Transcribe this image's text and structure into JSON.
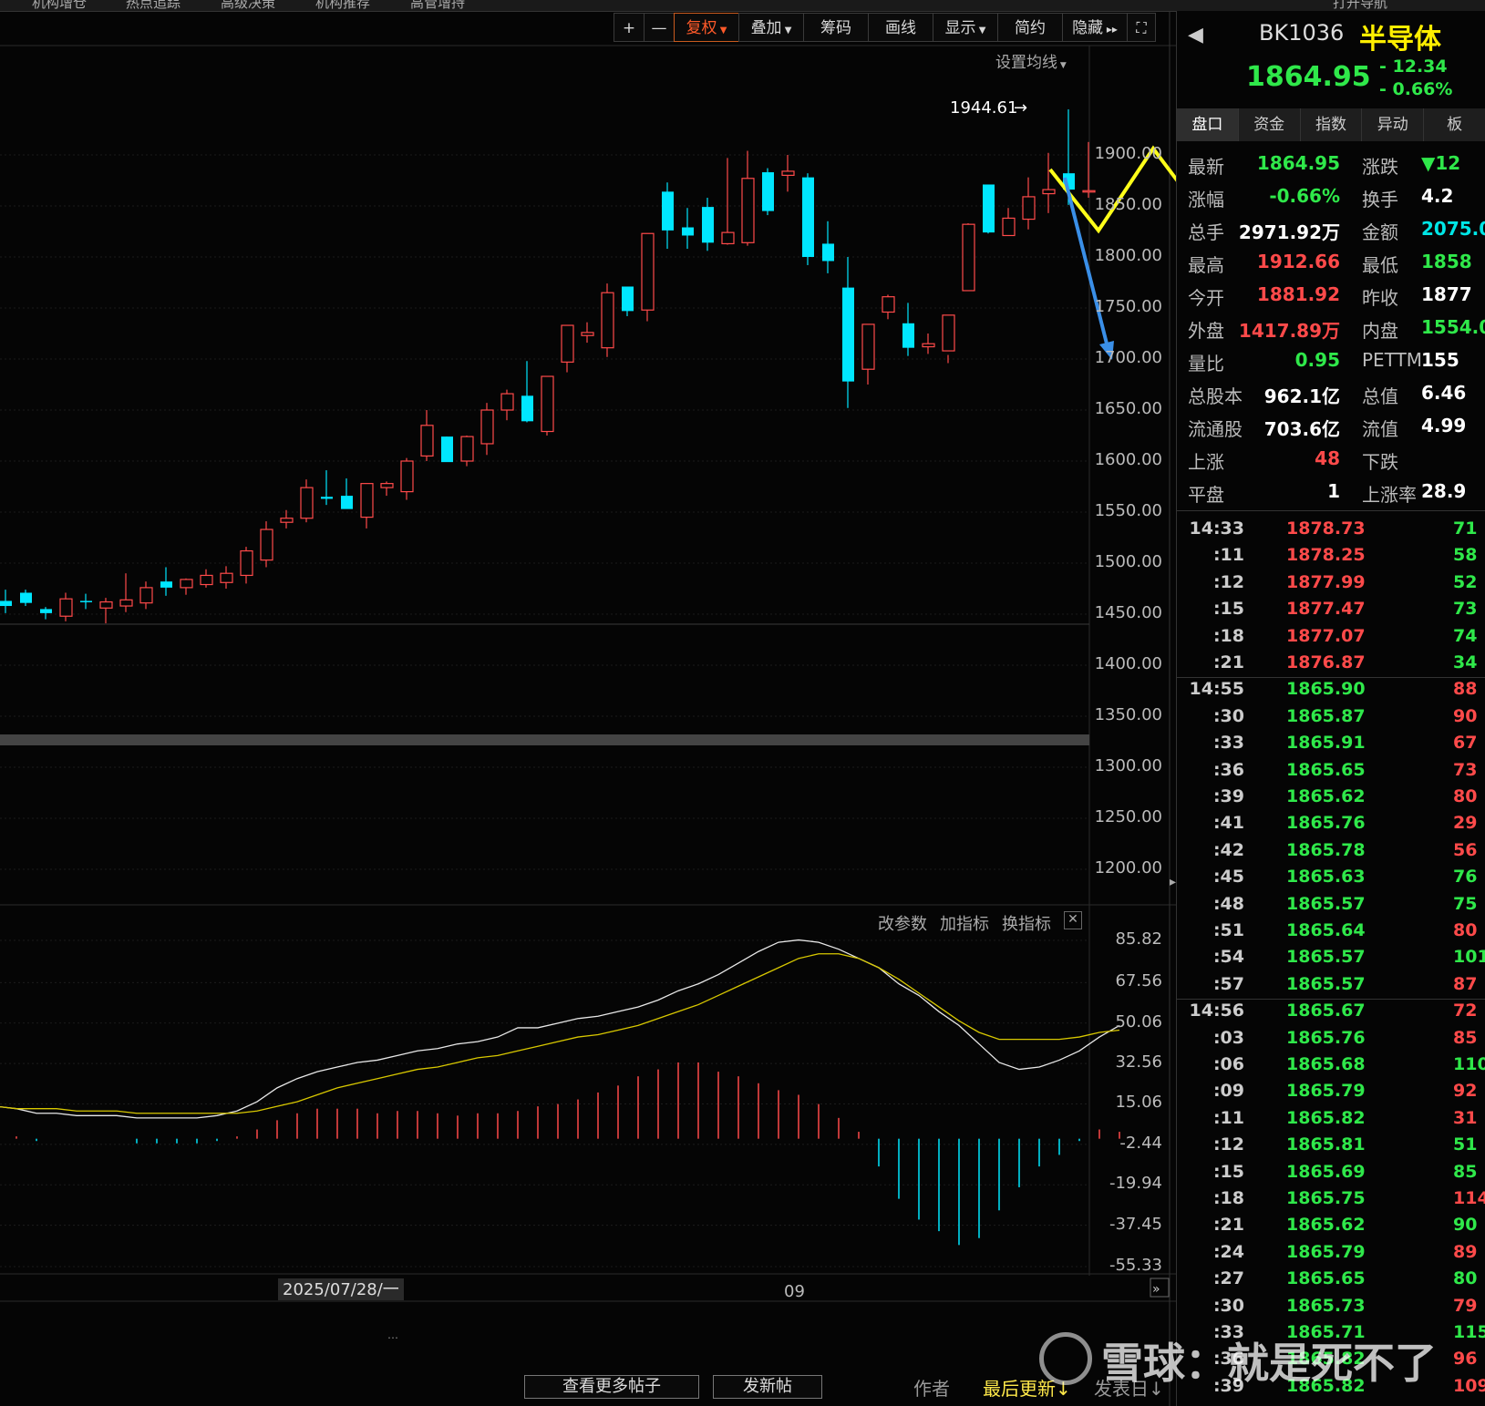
{
  "topbar": {
    "items": [
      "机构增仓",
      "热点追踪",
      "高级决策",
      "机构推荐",
      "高管增持",
      "打开导航"
    ]
  },
  "toolbar": {
    "buttons": [
      "+",
      "—",
      "复权",
      "叠加",
      "筹码",
      "画线",
      "显示",
      "简约",
      "隐藏"
    ]
  },
  "chart_header": {
    "ma_settings": "设置均线"
  },
  "price_axis": [
    "1900.00",
    "1850.00",
    "1800.00",
    "1750.00",
    "1700.00",
    "1650.00",
    "1600.00",
    "1550.00",
    "1500.00",
    "1450.00",
    "1400.00",
    "1350.00",
    "1300.00",
    "1250.00",
    "1200.00"
  ],
  "high_marker": "1944.61",
  "indicator": {
    "controls": [
      "改参数",
      "加指标",
      "换指标"
    ],
    "axis": [
      "85.82",
      "67.56",
      "50.06",
      "32.56",
      "15.06",
      "-2.44",
      "-19.94",
      "-37.45",
      "-55.33"
    ]
  },
  "x_axis": {
    "date_label": "2025/07/28/一",
    "month_label": "09"
  },
  "stock": {
    "code": "BK1036",
    "name": "半导体",
    "price": "1864.95",
    "change": "- 12.34",
    "pct": "- 0.66%"
  },
  "panel_tabs": [
    "盘口",
    "资金",
    "指数",
    "异动",
    "板"
  ],
  "quote": [
    {
      "l1": "最新",
      "v1": "1864.95",
      "c1": "green",
      "l2": "涨跌",
      "v2": "▼12",
      "c2": "green"
    },
    {
      "l1": "涨幅",
      "v1": "-0.66%",
      "c1": "green",
      "l2": "换手",
      "v2": "4.2",
      "c2": "white"
    },
    {
      "l1": "总手",
      "v1": "2971.92万",
      "c1": "white",
      "l2": "金额",
      "v2": "2075.0",
      "c2": "cyan"
    },
    {
      "l1": "最高",
      "v1": "1912.66",
      "c1": "red",
      "l2": "最低",
      "v2": "1858",
      "c2": "green"
    },
    {
      "l1": "今开",
      "v1": "1881.92",
      "c1": "red",
      "l2": "昨收",
      "v2": "1877",
      "c2": "white"
    },
    {
      "l1": "外盘",
      "v1": "1417.89万",
      "c1": "red",
      "l2": "内盘",
      "v2": "1554.0",
      "c2": "green"
    },
    {
      "l1": "量比",
      "v1": "0.95",
      "c1": "green",
      "l2": "PETTM",
      "v2": "155",
      "c2": "white"
    },
    {
      "l1": "总股本",
      "v1": "962.1亿",
      "c1": "white",
      "l2": "总值",
      "v2": "6.46",
      "c2": "white"
    },
    {
      "l1": "流通股",
      "v1": "703.6亿",
      "c1": "white",
      "l2": "流值",
      "v2": "4.99",
      "c2": "white"
    },
    {
      "l1": "上涨",
      "v1": "48",
      "c1": "red",
      "l2": "下跌",
      "v2": "",
      "c2": "green"
    },
    {
      "l1": "平盘",
      "v1": "1",
      "c1": "white",
      "l2": "上涨率",
      "v2": "28.9",
      "c2": "white"
    }
  ],
  "ticks": [
    {
      "t": "14:33",
      "p": "1878.73",
      "pc": "red",
      "v": "71",
      "vc": "green",
      "bold": true
    },
    {
      "t": ":11",
      "p": "1878.25",
      "pc": "red",
      "v": "58",
      "vc": "green"
    },
    {
      "t": ":12",
      "p": "1877.99",
      "pc": "red",
      "v": "52",
      "vc": "green"
    },
    {
      "t": ":15",
      "p": "1877.47",
      "pc": "red",
      "v": "73",
      "vc": "green"
    },
    {
      "t": ":18",
      "p": "1877.07",
      "pc": "red",
      "v": "74",
      "vc": "green"
    },
    {
      "t": ":21",
      "p": "1876.87",
      "pc": "red",
      "v": "34",
      "vc": "green"
    },
    {
      "t": "14:55",
      "p": "1865.90",
      "pc": "green",
      "v": "88",
      "vc": "red",
      "bold": true
    },
    {
      "t": ":30",
      "p": "1865.87",
      "pc": "green",
      "v": "90",
      "vc": "red"
    },
    {
      "t": ":33",
      "p": "1865.91",
      "pc": "green",
      "v": "67",
      "vc": "red"
    },
    {
      "t": ":36",
      "p": "1865.65",
      "pc": "green",
      "v": "73",
      "vc": "red"
    },
    {
      "t": ":39",
      "p": "1865.62",
      "pc": "green",
      "v": "80",
      "vc": "red"
    },
    {
      "t": ":41",
      "p": "1865.76",
      "pc": "green",
      "v": "29",
      "vc": "red"
    },
    {
      "t": ":42",
      "p": "1865.78",
      "pc": "green",
      "v": "56",
      "vc": "red"
    },
    {
      "t": ":45",
      "p": "1865.63",
      "pc": "green",
      "v": "76",
      "vc": "green"
    },
    {
      "t": ":48",
      "p": "1865.57",
      "pc": "green",
      "v": "75",
      "vc": "green"
    },
    {
      "t": ":51",
      "p": "1865.64",
      "pc": "green",
      "v": "80",
      "vc": "red"
    },
    {
      "t": ":54",
      "p": "1865.57",
      "pc": "green",
      "v": "101",
      "vc": "green"
    },
    {
      "t": ":57",
      "p": "1865.57",
      "pc": "green",
      "v": "87",
      "vc": "red"
    },
    {
      "t": "14:56",
      "p": "1865.67",
      "pc": "green",
      "v": "72",
      "vc": "red",
      "bold": true
    },
    {
      "t": ":03",
      "p": "1865.76",
      "pc": "green",
      "v": "85",
      "vc": "red"
    },
    {
      "t": ":06",
      "p": "1865.68",
      "pc": "green",
      "v": "110",
      "vc": "green"
    },
    {
      "t": ":09",
      "p": "1865.79",
      "pc": "green",
      "v": "92",
      "vc": "red"
    },
    {
      "t": ":11",
      "p": "1865.82",
      "pc": "green",
      "v": "31",
      "vc": "red"
    },
    {
      "t": ":12",
      "p": "1865.81",
      "pc": "green",
      "v": "51",
      "vc": "green"
    },
    {
      "t": ":15",
      "p": "1865.69",
      "pc": "green",
      "v": "85",
      "vc": "green"
    },
    {
      "t": ":18",
      "p": "1865.75",
      "pc": "green",
      "v": "114",
      "vc": "red"
    },
    {
      "t": ":21",
      "p": "1865.62",
      "pc": "green",
      "v": "90",
      "vc": "green"
    },
    {
      "t": ":24",
      "p": "1865.79",
      "pc": "green",
      "v": "89",
      "vc": "red"
    },
    {
      "t": ":27",
      "p": "1865.65",
      "pc": "green",
      "v": "80",
      "vc": "green"
    },
    {
      "t": ":30",
      "p": "1865.73",
      "pc": "green",
      "v": "79",
      "vc": "red"
    },
    {
      "t": ":33",
      "p": "1865.71",
      "pc": "green",
      "v": "115",
      "vc": "green"
    },
    {
      "t": ":36",
      "p": "1865.82",
      "pc": "green",
      "v": "96",
      "vc": "red"
    },
    {
      "t": ":39",
      "p": "1865.82",
      "pc": "green",
      "v": "109",
      "vc": "red"
    }
  ],
  "bottom": {
    "more_posts": "查看更多帖子",
    "new_post": "发新帖",
    "author": "作者",
    "last_update": "最后更新↓",
    "post_date": "发表日↓"
  },
  "watermark": "雪球：就是死不了",
  "candles": [
    [
      1463,
      1474,
      1451,
      1458
    ],
    [
      1471,
      1474,
      1458,
      1461
    ],
    [
      1455,
      1457,
      1445,
      1451
    ],
    [
      1448,
      1471,
      1443,
      1465
    ],
    [
      1463,
      1470,
      1455,
      1462
    ],
    [
      1456,
      1466,
      1441,
      1462
    ],
    [
      1458,
      1490,
      1452,
      1464
    ],
    [
      1461,
      1482,
      1455,
      1476
    ],
    [
      1482,
      1496,
      1468,
      1476
    ],
    [
      1476,
      1485,
      1469,
      1484
    ],
    [
      1479,
      1494,
      1476,
      1488
    ],
    [
      1481,
      1497,
      1475,
      1490
    ],
    [
      1488,
      1516,
      1480,
      1512
    ],
    [
      1503,
      1541,
      1496,
      1533
    ],
    [
      1540,
      1552,
      1534,
      1544
    ],
    [
      1544,
      1582,
      1540,
      1574
    ],
    [
      1565,
      1591,
      1557,
      1563
    ],
    [
      1566,
      1583,
      1554,
      1553
    ],
    [
      1545,
      1570,
      1534,
      1578
    ],
    [
      1574,
      1580,
      1566,
      1578
    ],
    [
      1570,
      1603,
      1562,
      1600
    ],
    [
      1605,
      1650,
      1600,
      1635
    ],
    [
      1624,
      1624,
      1604,
      1599
    ],
    [
      1600,
      1625,
      1595,
      1624
    ],
    [
      1617,
      1657,
      1606,
      1650
    ],
    [
      1650,
      1670,
      1640,
      1666
    ],
    [
      1664,
      1698,
      1638,
      1639
    ],
    [
      1629,
      1668,
      1625,
      1683
    ],
    [
      1697,
      1722,
      1687,
      1733
    ],
    [
      1723,
      1736,
      1716,
      1726
    ],
    [
      1711,
      1774,
      1702,
      1765
    ],
    [
      1771,
      1767,
      1742,
      1747
    ],
    [
      1748,
      1806,
      1737,
      1823
    ],
    [
      1864,
      1873,
      1808,
      1826
    ],
    [
      1829,
      1848,
      1808,
      1821
    ],
    [
      1849,
      1858,
      1806,
      1814
    ],
    [
      1813,
      1897,
      1812,
      1824
    ],
    [
      1814,
      1904,
      1811,
      1877
    ],
    [
      1883,
      1887,
      1841,
      1845
    ],
    [
      1880,
      1900,
      1864,
      1884
    ],
    [
      1878,
      1882,
      1792,
      1800
    ],
    [
      1813,
      1835,
      1784,
      1796
    ],
    [
      1770,
      1800,
      1652,
      1678
    ],
    [
      1690,
      1702,
      1675,
      1734
    ],
    [
      1746,
      1763,
      1739,
      1761
    ],
    [
      1735,
      1755,
      1703,
      1711
    ],
    [
      1712,
      1725,
      1705,
      1715
    ],
    [
      1708,
      1704,
      1696,
      1743
    ],
    [
      1767,
      1833,
      1815,
      1832
    ],
    [
      1871,
      1861,
      1823,
      1824
    ],
    [
      1821,
      1848,
      1823,
      1838
    ],
    [
      1837,
      1878,
      1827,
      1859
    ],
    [
      1862,
      1902,
      1843,
      1866
    ],
    [
      1882,
      1944.61,
      1851,
      1866
    ],
    [
      1864,
      1912.66,
      1858,
      1864.95
    ]
  ],
  "chart_data": {
    "type": "candlestick",
    "ylim": [
      1200,
      1945
    ],
    "y_ticks": [
      1900,
      1850,
      1800,
      1750,
      1700,
      1650,
      1600,
      1550,
      1500,
      1450,
      1400,
      1350,
      1300,
      1250,
      1200
    ],
    "high_label": 1944.61,
    "macd": {
      "ylim": [
        -55.33,
        85.82
      ],
      "dif": [
        14,
        13,
        11,
        11,
        10,
        10,
        10,
        9,
        9,
        9,
        9,
        10,
        12,
        16,
        22,
        26,
        29,
        31,
        33,
        34,
        36,
        38,
        39,
        41,
        42,
        44,
        48,
        48,
        50,
        52,
        53,
        55,
        57,
        60,
        64,
        67,
        71,
        76,
        81,
        85,
        86,
        85,
        82,
        78,
        74,
        67,
        62,
        55,
        49,
        41,
        33,
        30,
        31,
        34,
        38,
        44,
        49
      ],
      "dea": [
        14,
        13,
        13,
        13,
        12,
        12,
        12,
        11,
        11,
        11,
        11,
        11,
        11,
        12,
        14,
        16,
        19,
        22,
        24,
        26,
        28,
        30,
        31,
        33,
        35,
        36,
        38,
        40,
        42,
        44,
        45,
        47,
        49,
        52,
        55,
        58,
        62,
        66,
        70,
        74,
        78,
        80,
        80,
        78,
        74,
        69,
        63,
        57,
        51,
        46,
        43,
        43,
        43,
        43,
        44,
        46,
        47
      ],
      "hist": [
        3,
        1,
        -1,
        0,
        0,
        0,
        0,
        -2,
        -2,
        -2,
        -2,
        -1,
        1,
        4,
        8,
        11,
        13,
        13,
        13,
        11,
        12,
        12,
        11,
        10,
        11,
        11,
        12,
        14,
        15,
        17,
        20,
        23,
        27,
        30,
        33,
        33,
        29,
        27,
        24,
        21,
        19,
        15,
        9,
        3,
        -12,
        -26,
        -35,
        -40,
        -46,
        -43,
        -31,
        -21,
        -12,
        -7,
        -1,
        4,
        3
      ]
    }
  }
}
